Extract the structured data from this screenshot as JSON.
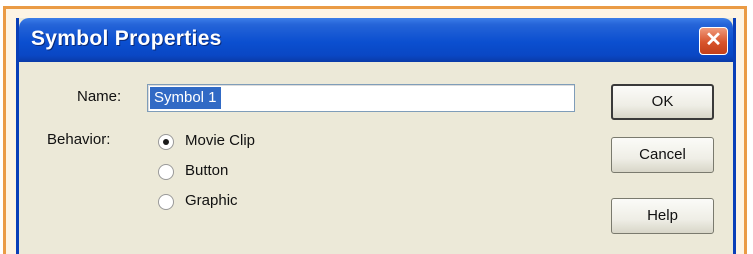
{
  "window": {
    "title": "Symbol Properties",
    "close_glyph": "✕"
  },
  "form": {
    "name_label": "Name:",
    "name_value": "Symbol 1",
    "behavior_label": "Behavior:",
    "behavior_options": [
      {
        "label": "Movie Clip",
        "selected": true
      },
      {
        "label": "Button",
        "selected": false
      },
      {
        "label": "Graphic",
        "selected": false
      }
    ]
  },
  "buttons": {
    "ok": "OK",
    "cancel": "Cancel",
    "help": "Help"
  },
  "colors": {
    "titlebar": "#0a47c4",
    "frame_border": "#ea9b45",
    "dialog_face": "#ece9d8",
    "selection": "#316ac5"
  }
}
